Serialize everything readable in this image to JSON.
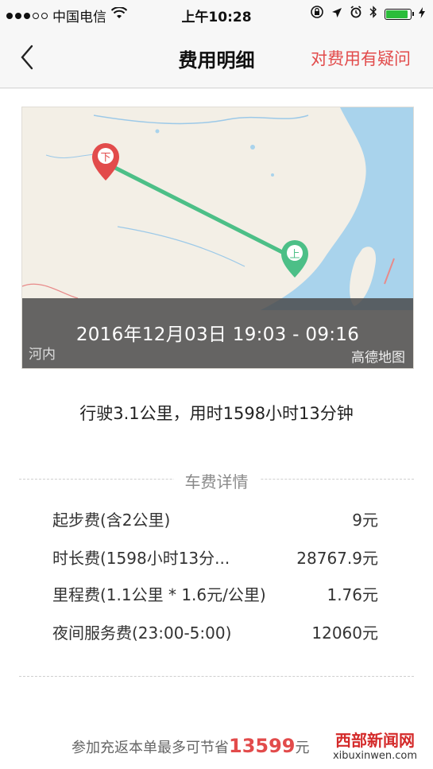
{
  "status_bar": {
    "carrier": "中国电信",
    "time": "上午10:28"
  },
  "nav": {
    "title": "费用明细",
    "right_action": "对费用有疑问"
  },
  "map": {
    "end_marker": "下",
    "start_marker": "上",
    "time_range": "2016年12月03日 19:03 - 09:16",
    "city_label": "河内",
    "brand": "高德地图",
    "route_color": "#4cbf87",
    "end_marker_color": "#e24b4b",
    "start_marker_color": "#4cbf87"
  },
  "trip_summary": "行驶3.1公里，用时1598小时13分钟",
  "fee_section": {
    "title": "车费详情",
    "items": [
      {
        "label": "起步费(含2公里)",
        "value": "9元"
      },
      {
        "label": "时长费(1598小时13分...",
        "value": "28767.9元"
      },
      {
        "label": "里程费(1.1公里 * 1.6元/公里)",
        "value": "1.76元"
      },
      {
        "label": "夜间服务费(23:00-5:00)",
        "value": "12060元"
      }
    ]
  },
  "promo": {
    "prefix": "参加充返本单最多可节省",
    "amount": "13599",
    "unit": "元"
  },
  "watermark": {
    "name": "西部新闻网",
    "url": "xibuxinwen.com"
  },
  "icons": {
    "back": "chevron-left-icon",
    "wifi": "wifi-icon",
    "location": "location-arrow-icon",
    "alarm": "alarm-icon",
    "bluetooth": "bluetooth-icon",
    "lock_rotation": "rotation-lock-icon",
    "battery": "battery-icon"
  }
}
